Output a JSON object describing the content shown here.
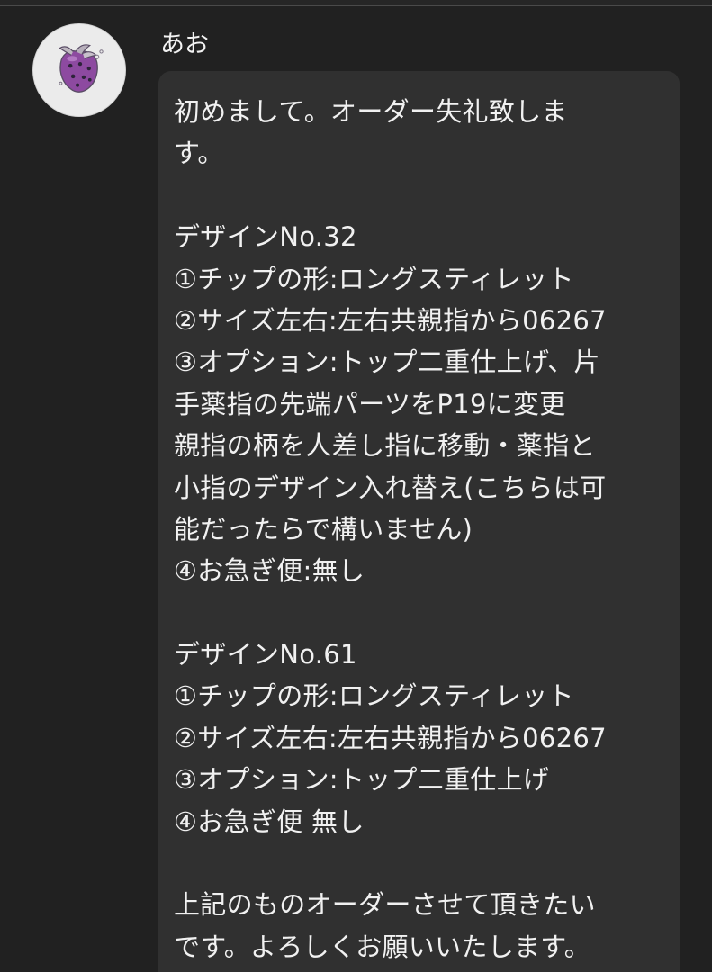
{
  "message": {
    "sender_name": "あお",
    "avatar_icon": "strawberry-icon",
    "lines": [
      "初めまして。オーダー失礼致しま",
      "す。",
      "",
      "デザインNo.32",
      "①チップの形:ロングスティレット",
      "②サイズ左右:左右共親指から06267",
      "③オプション:トップ二重仕上げ、片",
      "手薬指の先端パーツをP19に変更",
      "親指の柄を人差し指に移動・薬指と",
      "小指のデザイン入れ替え(こちらは可",
      "能だったらで構いません)",
      "④お急ぎ便:無し",
      "",
      "デザインNo.61",
      "①チップの形:ロングスティレット",
      "②サイズ左右:左右共親指から06267",
      "③オプション:トップ二重仕上げ",
      "④お急ぎ便 無し",
      "",
      "上記のものオーダーさせて頂きたい",
      "です。よろしくお願いいたします。"
    ]
  },
  "colors": {
    "background": "#212121",
    "bubble": "#303030",
    "text": "#f1f1f1",
    "avatar_background": "#e9e9e9",
    "strawberry": "#8e4a9e"
  }
}
